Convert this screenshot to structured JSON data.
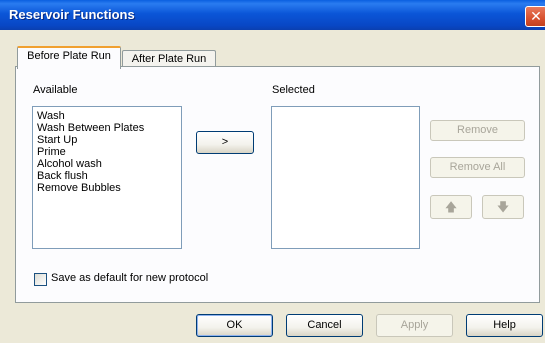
{
  "window": {
    "title": "Reservoir Functions",
    "close_glyph": "✕"
  },
  "tabs": [
    {
      "label": "Before Plate Run",
      "active": true
    },
    {
      "label": "After Plate Run",
      "active": false
    }
  ],
  "available": {
    "label": "Available",
    "items": [
      "Wash",
      "Wash Between Plates",
      "Start Up",
      "Prime",
      "Alcohol wash",
      "Back flush",
      "Remove Bubbles"
    ]
  },
  "selected": {
    "label": "Selected",
    "items": []
  },
  "buttons": {
    "add": ">",
    "remove": "Remove",
    "remove_all": "Remove All",
    "move_up_icon": "arrow-up-icon",
    "move_down_icon": "arrow-down-icon"
  },
  "checkbox": {
    "label": "Save as default for new protocol",
    "checked": false
  },
  "footer": {
    "ok": "OK",
    "cancel": "Cancel",
    "apply": "Apply",
    "help": "Help"
  }
}
